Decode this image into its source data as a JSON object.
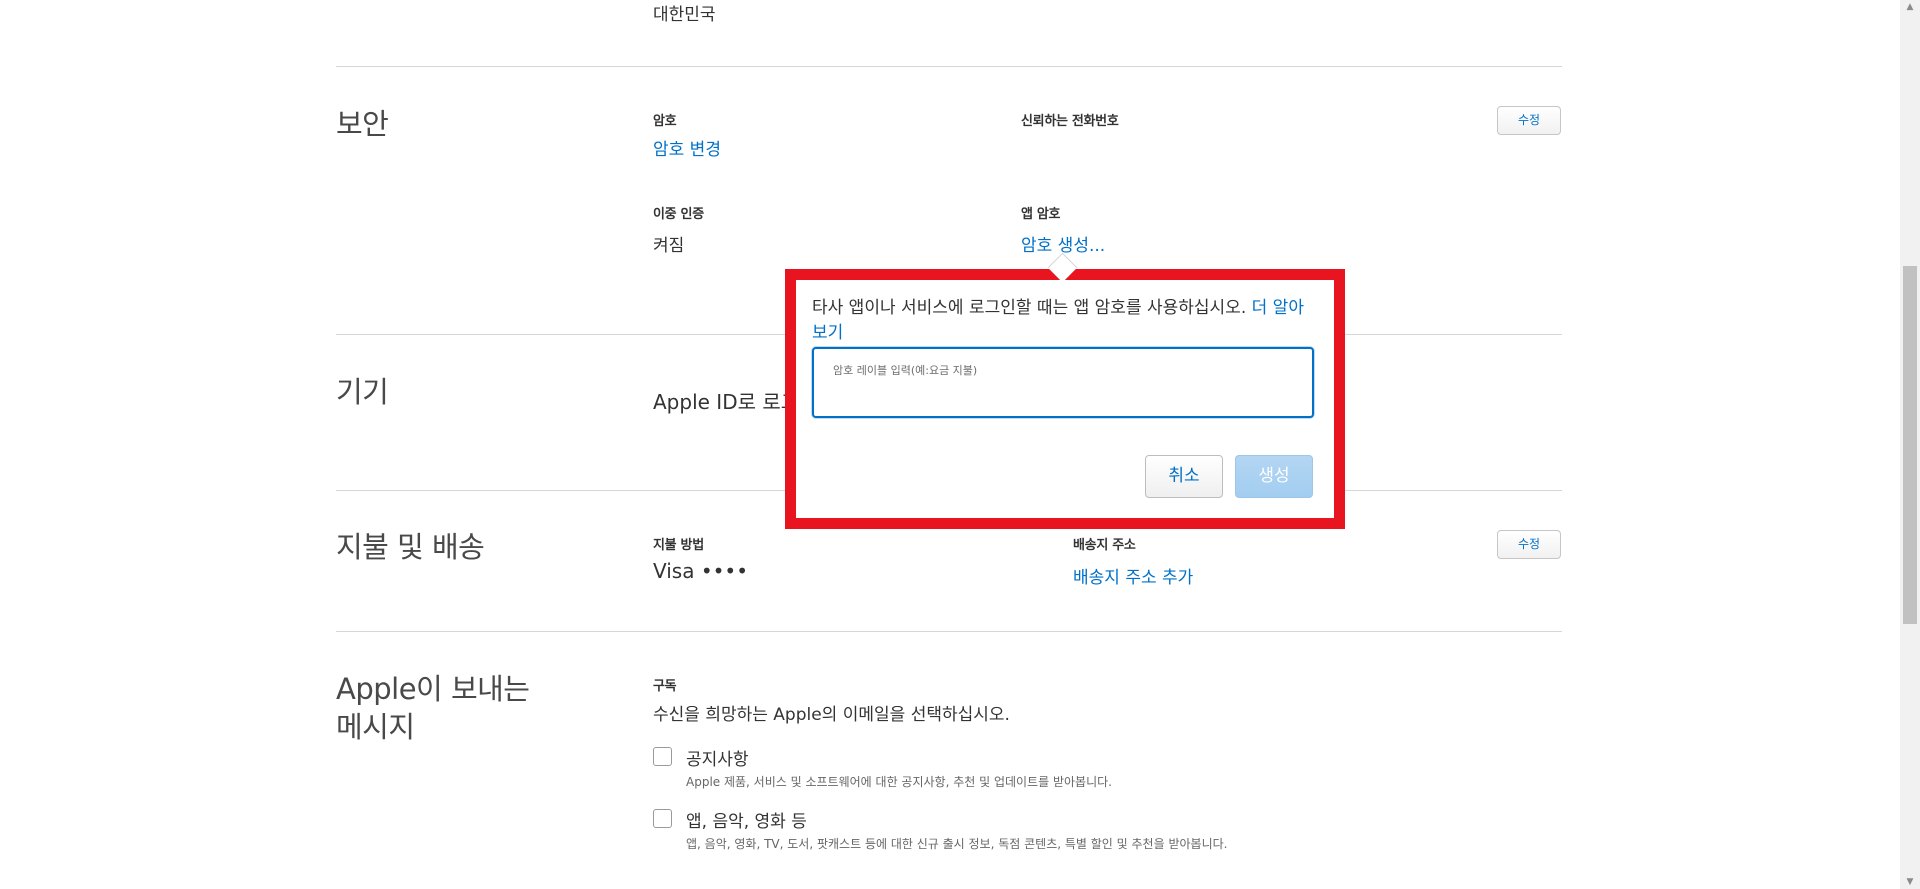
{
  "top": {
    "country_value": "대한민국"
  },
  "security": {
    "title": "보안",
    "password_label": "암호",
    "password_link": "암호 변경",
    "trusted_phone_label": "신뢰하는 전화번호",
    "edit_label": "수정",
    "two_factor_label": "이중 인증",
    "two_factor_value": "켜짐",
    "app_password_label": "앱 암호",
    "app_password_link": "암호 생성..."
  },
  "popup": {
    "message": "타사 앱이나 서비스에 로그인할 때는 앱 암호를 사용하십시오.",
    "learn_more": "더 알아보기",
    "input_placeholder": "암호 레이블 입력(예:요금 지불)",
    "cancel_label": "취소",
    "generate_label": "생성"
  },
  "devices": {
    "title": "기기",
    "text": "Apple ID로 로그"
  },
  "payment": {
    "title": "지불 및 배송",
    "method_label": "지불 방법",
    "method_value": "Visa ••••",
    "shipping_label": "배송지 주소",
    "shipping_link": "배송지 주소 추가",
    "edit_label": "수정"
  },
  "messages": {
    "title_line1": "Apple이 보내는",
    "title_line2": "메시지",
    "subscription_label": "구독",
    "subscription_desc": "수신을 희망하는 Apple의 이메일을 선택하십시오.",
    "options": [
      {
        "label": "공지사항",
        "desc": "Apple 제품, 서비스 및 소프트웨어에 대한 공지사항, 추천 및 업데이트를 받아봅니다.",
        "checked": false
      },
      {
        "label": "앱, 음악, 영화 등",
        "desc": "앱, 음악, 영화, TV, 도서, 팟캐스트 등에 대한 신규 출시 정보, 독점 콘텐츠, 특별 할인 및 추천을 받아봅니다.",
        "checked": false
      }
    ]
  },
  "colors": {
    "link": "#0070c9",
    "highlight_frame": "#e8141f",
    "generate_disabled": "#a3cdf0"
  }
}
